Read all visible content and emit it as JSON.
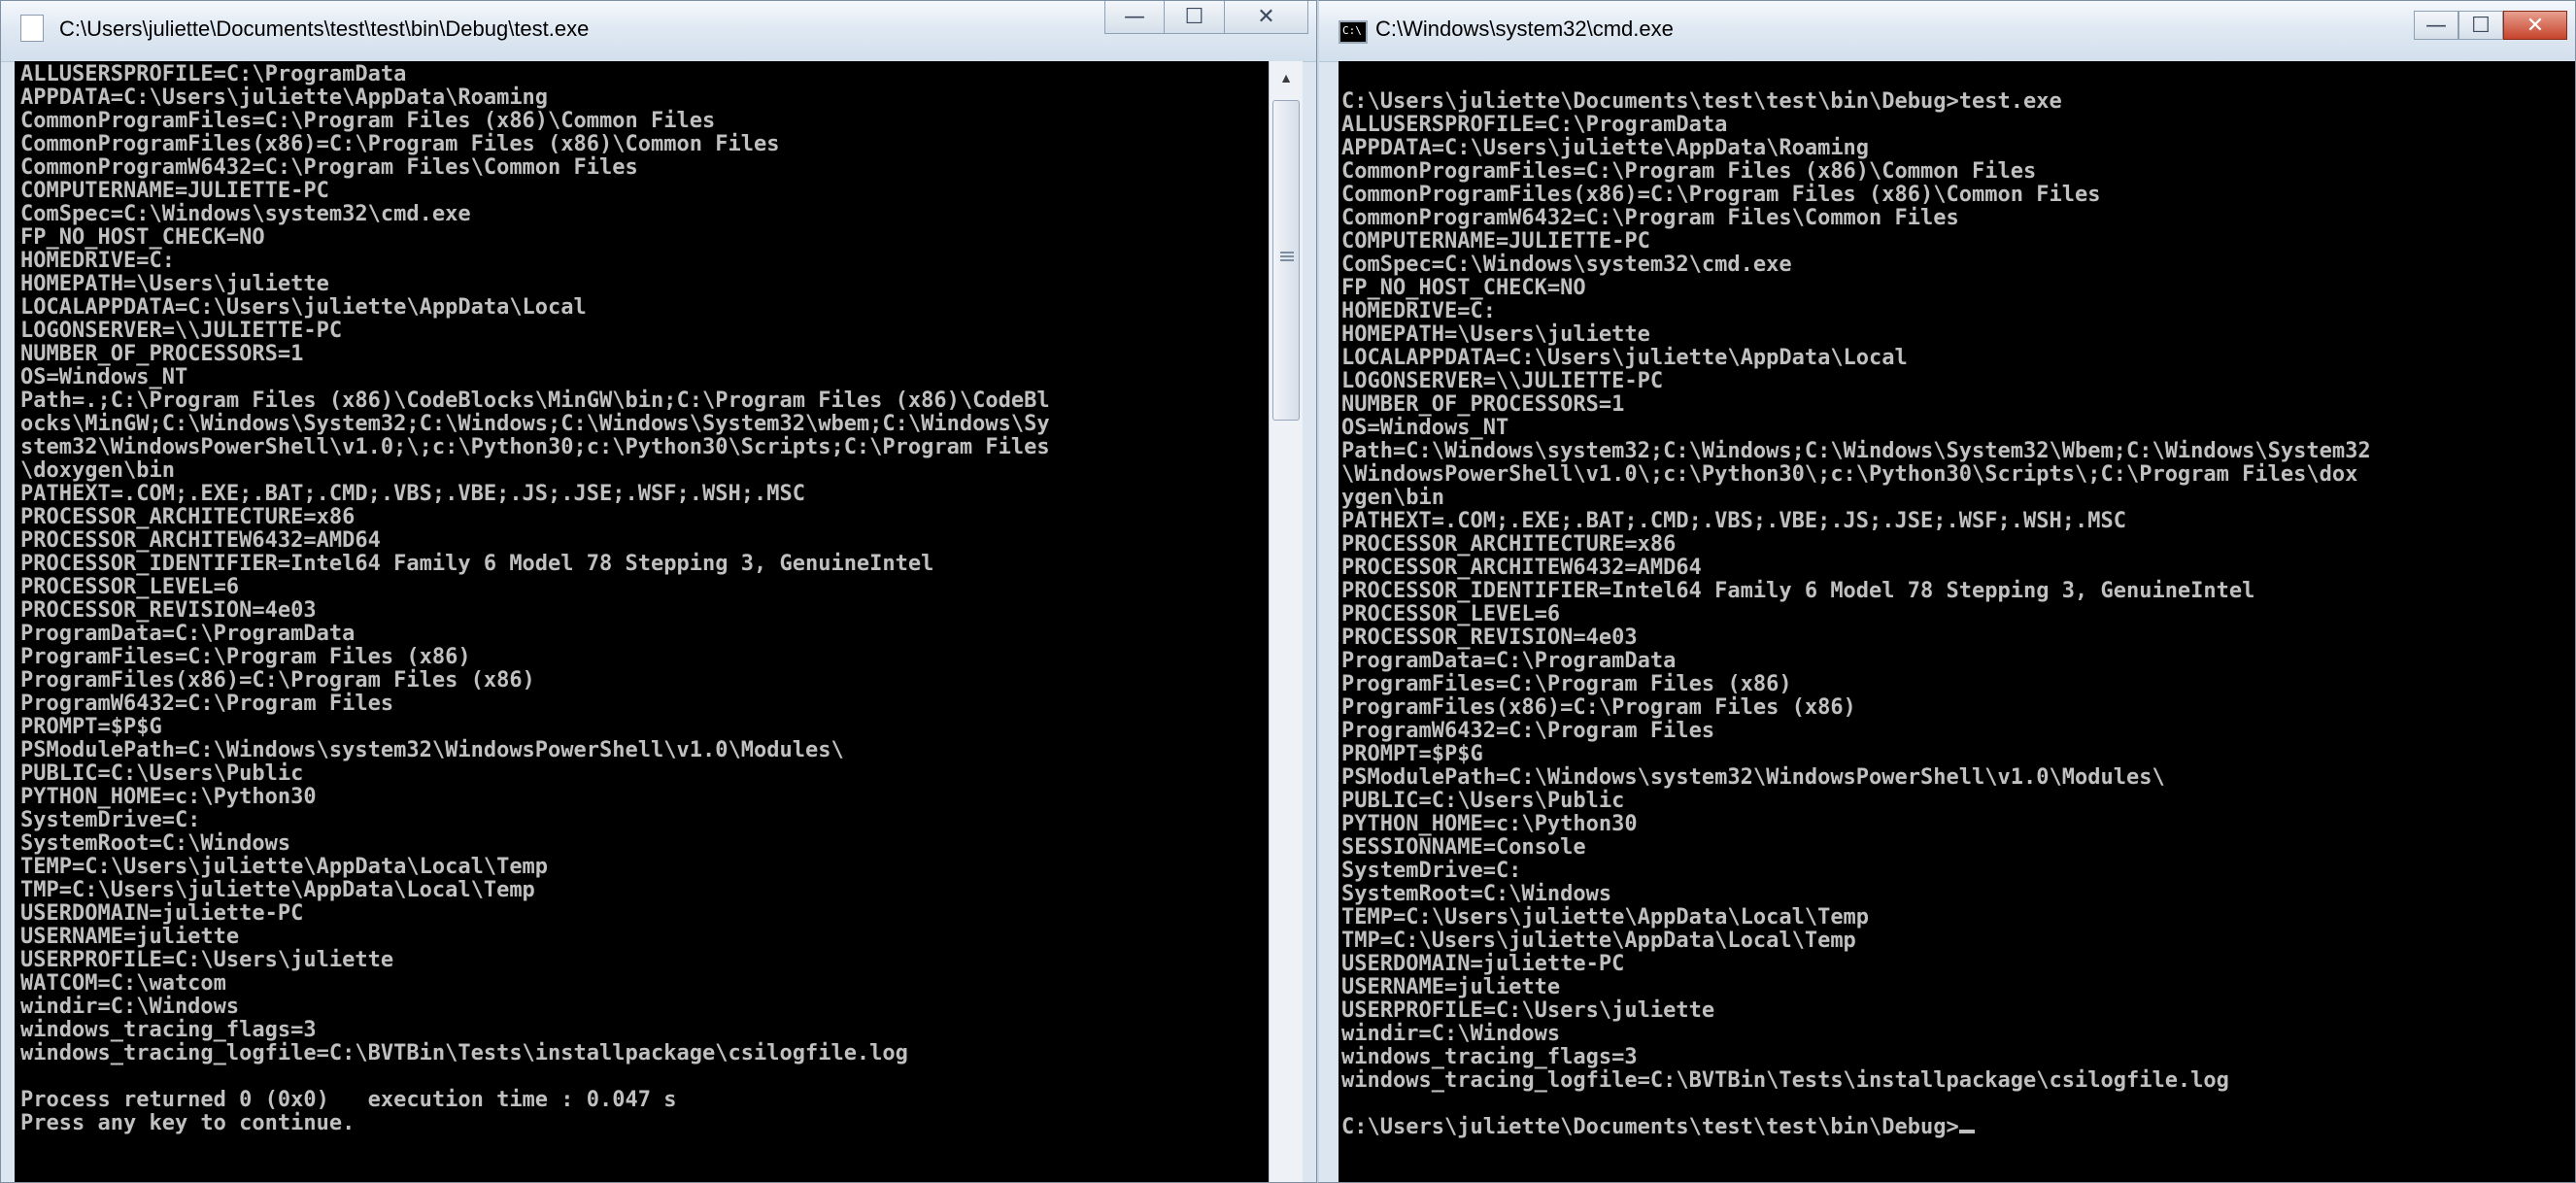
{
  "windows": {
    "left": {
      "title": "C:\\Users\\juliette\\Documents\\test\\test\\bin\\Debug\\test.exe",
      "controls": {
        "minimize": "—",
        "maximize": "☐",
        "close": "✕"
      },
      "console_text": "ALLUSERSPROFILE=C:\\ProgramData\nAPPDATA=C:\\Users\\juliette\\AppData\\Roaming\nCommonProgramFiles=C:\\Program Files (x86)\\Common Files\nCommonProgramFiles(x86)=C:\\Program Files (x86)\\Common Files\nCommonProgramW6432=C:\\Program Files\\Common Files\nCOMPUTERNAME=JULIETTE-PC\nComSpec=C:\\Windows\\system32\\cmd.exe\nFP_NO_HOST_CHECK=NO\nHOMEDRIVE=C:\nHOMEPATH=\\Users\\juliette\nLOCALAPPDATA=C:\\Users\\juliette\\AppData\\Local\nLOGONSERVER=\\\\JULIETTE-PC\nNUMBER_OF_PROCESSORS=1\nOS=Windows_NT\nPath=.;C:\\Program Files (x86)\\CodeBlocks\\MinGW\\bin;C:\\Program Files (x86)\\CodeBl\nocks\\MinGW;C:\\Windows\\System32;C:\\Windows;C:\\Windows\\System32\\wbem;C:\\Windows\\Sy\nstem32\\WindowsPowerShell\\v1.0;\\;c:\\Python30;c:\\Python30\\Scripts;C:\\Program Files\n\\doxygen\\bin\nPATHEXT=.COM;.EXE;.BAT;.CMD;.VBS;.VBE;.JS;.JSE;.WSF;.WSH;.MSC\nPROCESSOR_ARCHITECTURE=x86\nPROCESSOR_ARCHITEW6432=AMD64\nPROCESSOR_IDENTIFIER=Intel64 Family 6 Model 78 Stepping 3, GenuineIntel\nPROCESSOR_LEVEL=6\nPROCESSOR_REVISION=4e03\nProgramData=C:\\ProgramData\nProgramFiles=C:\\Program Files (x86)\nProgramFiles(x86)=C:\\Program Files (x86)\nProgramW6432=C:\\Program Files\nPROMPT=$P$G\nPSModulePath=C:\\Windows\\system32\\WindowsPowerShell\\v1.0\\Modules\\\nPUBLIC=C:\\Users\\Public\nPYTHON_HOME=c:\\Python30\nSystemDrive=C:\nSystemRoot=C:\\Windows\nTEMP=C:\\Users\\juliette\\AppData\\Local\\Temp\nTMP=C:\\Users\\juliette\\AppData\\Local\\Temp\nUSERDOMAIN=juliette-PC\nUSERNAME=juliette\nUSERPROFILE=C:\\Users\\juliette\nWATCOM=C:\\watcom\nwindir=C:\\Windows\nwindows_tracing_flags=3\nwindows_tracing_logfile=C:\\BVTBin\\Tests\\installpackage\\csilogfile.log\n\nProcess returned 0 (0x0)   execution time : 0.047 s\nPress any key to continue."
    },
    "right": {
      "title": "C:\\Windows\\system32\\cmd.exe",
      "icon_text": "C:\\",
      "controls": {
        "minimize": "—",
        "maximize": "☐",
        "close": "✕"
      },
      "console_text": "C:\\Users\\juliette\\Documents\\test\\test\\bin\\Debug>test.exe\nALLUSERSPROFILE=C:\\ProgramData\nAPPDATA=C:\\Users\\juliette\\AppData\\Roaming\nCommonProgramFiles=C:\\Program Files (x86)\\Common Files\nCommonProgramFiles(x86)=C:\\Program Files (x86)\\Common Files\nCommonProgramW6432=C:\\Program Files\\Common Files\nCOMPUTERNAME=JULIETTE-PC\nComSpec=C:\\Windows\\system32\\cmd.exe\nFP_NO_HOST_CHECK=NO\nHOMEDRIVE=C:\nHOMEPATH=\\Users\\juliette\nLOCALAPPDATA=C:\\Users\\juliette\\AppData\\Local\nLOGONSERVER=\\\\JULIETTE-PC\nNUMBER_OF_PROCESSORS=1\nOS=Windows_NT\nPath=C:\\Windows\\system32;C:\\Windows;C:\\Windows\\System32\\Wbem;C:\\Windows\\System32\n\\WindowsPowerShell\\v1.0\\;c:\\Python30\\;c:\\Python30\\Scripts\\;C:\\Program Files\\dox\nygen\\bin\nPATHEXT=.COM;.EXE;.BAT;.CMD;.VBS;.VBE;.JS;.JSE;.WSF;.WSH;.MSC\nPROCESSOR_ARCHITECTURE=x86\nPROCESSOR_ARCHITEW6432=AMD64\nPROCESSOR_IDENTIFIER=Intel64 Family 6 Model 78 Stepping 3, GenuineIntel\nPROCESSOR_LEVEL=6\nPROCESSOR_REVISION=4e03\nProgramData=C:\\ProgramData\nProgramFiles=C:\\Program Files (x86)\nProgramFiles(x86)=C:\\Program Files (x86)\nProgramW6432=C:\\Program Files\nPROMPT=$P$G\nPSModulePath=C:\\Windows\\system32\\WindowsPowerShell\\v1.0\\Modules\\\nPUBLIC=C:\\Users\\Public\nPYTHON_HOME=c:\\Python30\nSESSIONNAME=Console\nSystemDrive=C:\nSystemRoot=C:\\Windows\nTEMP=C:\\Users\\juliette\\AppData\\Local\\Temp\nTMP=C:\\Users\\juliette\\AppData\\Local\\Temp\nUSERDOMAIN=juliette-PC\nUSERNAME=juliette\nUSERPROFILE=C:\\Users\\juliette\nwindir=C:\\Windows\nwindows_tracing_flags=3\nwindows_tracing_logfile=C:\\BVTBin\\Tests\\installpackage\\csilogfile.log\n\nC:\\Users\\juliette\\Documents\\test\\test\\bin\\Debug>"
    }
  },
  "colors": {
    "console_bg": "#000000",
    "console_fg": "#c0c0c0",
    "titlebar": "#dbe6f1"
  }
}
